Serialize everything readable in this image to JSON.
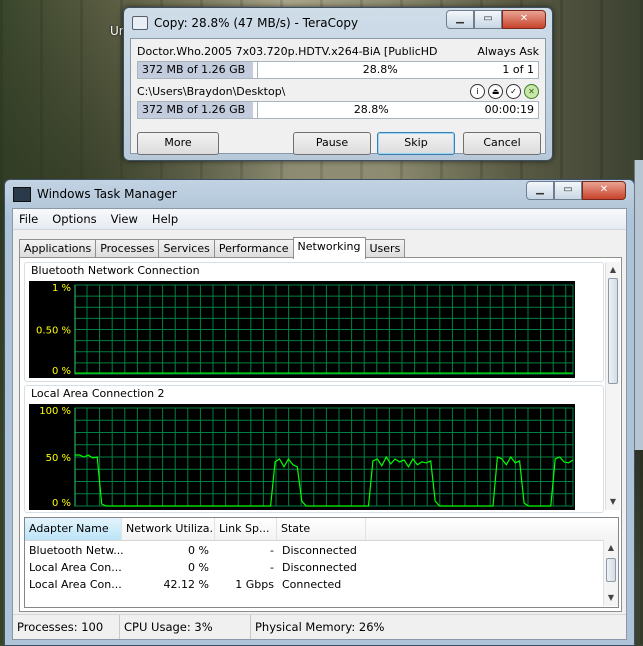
{
  "desktop": {
    "partial_icon_label": "Ur"
  },
  "teracopy": {
    "title": "Copy: 28.8%  (47 MB/s) - TeraCopy",
    "filename": "Doctor.Who.2005 7x03.720p.HDTV.x264-BiA [PublicHD",
    "overwrite_mode": "Always Ask",
    "file_progress": {
      "size": "372 MB of 1.26 GB",
      "percent": "28.8%",
      "count": "1 of 1",
      "fraction": 0.288
    },
    "destination": "C:\\Users\\Braydon\\Desktop\\",
    "total_progress": {
      "size": "372 MB of 1.26 GB",
      "percent": "28.8%",
      "elapsed": "00:00:19",
      "fraction": 0.288
    },
    "buttons": {
      "more": "More",
      "pause": "Pause",
      "skip": "Skip",
      "cancel": "Cancel"
    },
    "icons": [
      "info-icon",
      "eject-icon",
      "check-icon",
      "close-green-icon"
    ]
  },
  "task_manager": {
    "title": "Windows Task Manager",
    "menu": [
      "File",
      "Options",
      "View",
      "Help"
    ],
    "tabs": [
      "Applications",
      "Processes",
      "Services",
      "Performance",
      "Networking",
      "Users"
    ],
    "active_tab": "Networking",
    "graph1": {
      "label": "Bluetooth Network Connection",
      "ticks": [
        "1 %",
        "0.50 %",
        "0 %"
      ]
    },
    "graph2": {
      "label": "Local Area Connection 2",
      "ticks": [
        "100 %",
        "50 %",
        "0 %"
      ]
    },
    "adapter_columns": [
      "Adapter Name",
      "Network Utiliza...",
      "Link Sp...",
      "State"
    ],
    "adapters": [
      {
        "name": "Bluetooth Netw...",
        "util": "0 %",
        "speed": "-",
        "state": "Disconnected"
      },
      {
        "name": "Local Area Con...",
        "util": "0 %",
        "speed": "-",
        "state": "Disconnected"
      },
      {
        "name": "Local Area Con...",
        "util": "42.12 %",
        "speed": "1 Gbps",
        "state": "Connected"
      }
    ],
    "status": {
      "processes": "Processes: 100",
      "cpu": "CPU Usage: 3%",
      "memory": "Physical Memory: 26%"
    }
  },
  "colors": {
    "graph_bg": "#000000",
    "grid": "#008040",
    "trace": "#00ff00",
    "tick_text": "#ffff00"
  },
  "chart_data": {
    "type": "line",
    "title": "Local Area Connection 2",
    "ylim": [
      0,
      100
    ],
    "series": [
      {
        "values": [
          52,
          52,
          50,
          52,
          49,
          50,
          2,
          0,
          0,
          0,
          0,
          0,
          0,
          0,
          0,
          0,
          0,
          0,
          0,
          0,
          0,
          0,
          0,
          0,
          0,
          0,
          0,
          0,
          0,
          0,
          0,
          0,
          0,
          0,
          0,
          0,
          0,
          0,
          0,
          0,
          0,
          0,
          0,
          0,
          0,
          45,
          48,
          40,
          48,
          42,
          40,
          5,
          0,
          0,
          0,
          0,
          0,
          0,
          0,
          0,
          0,
          0,
          0,
          0,
          0,
          0,
          0,
          46,
          48,
          41,
          50,
          43,
          48,
          45,
          47,
          40,
          48,
          42,
          45,
          44,
          46,
          5,
          0,
          0,
          0,
          0,
          0,
          0,
          0,
          0,
          0,
          0,
          0,
          0,
          0,
          50,
          48,
          42,
          50,
          44,
          46,
          3,
          0,
          0,
          0,
          0,
          0,
          0,
          48,
          50,
          45,
          44,
          47
        ]
      }
    ]
  }
}
